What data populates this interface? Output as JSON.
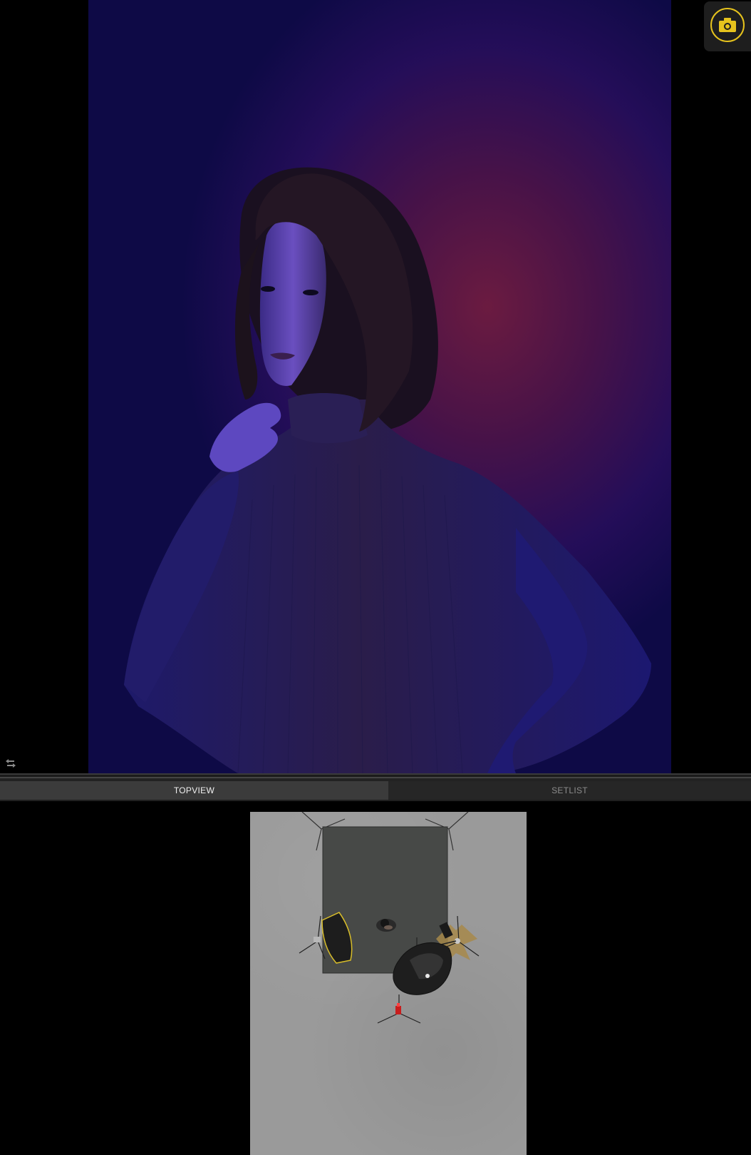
{
  "viewer": {
    "shutter_button": "camera-icon",
    "swap_control": "swap-arrows-icon",
    "accent_color": "#e6c31d"
  },
  "tabs": [
    {
      "label": "TOPVIEW",
      "active": true
    },
    {
      "label": "SETLIST",
      "active": false
    }
  ],
  "topview": {
    "items": [
      "backdrop",
      "model",
      "softbox",
      "umbrella-light",
      "gobo-light",
      "camera"
    ]
  }
}
